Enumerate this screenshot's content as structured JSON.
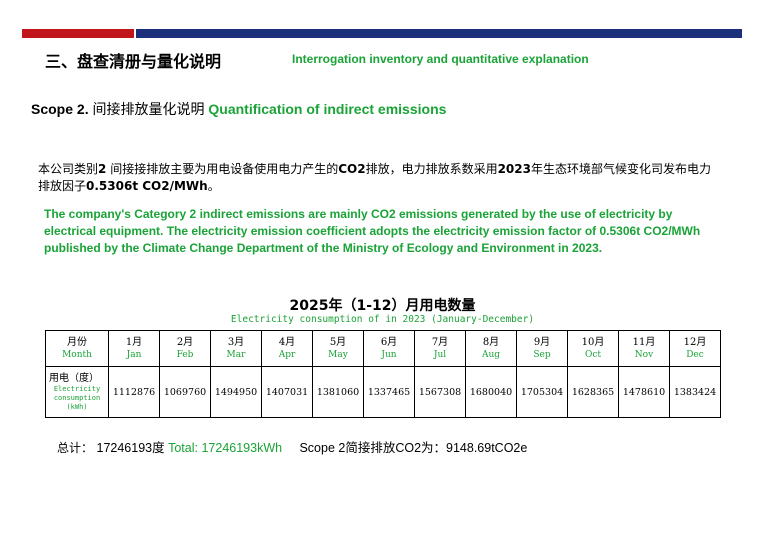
{
  "header": {
    "section_cn": "三、盘查清册与量化说明",
    "section_en": "Interrogation inventory and quantitative explanation",
    "accent_red": "#c0161c",
    "accent_blue": "#1c2f7a",
    "accent_green": "#1aa337"
  },
  "scope": {
    "label": "Scope 2.",
    "title_cn": "间接排放量化说明",
    "title_en": "Quantification of indirect emissions"
  },
  "paragraph_cn": {
    "p1": "本公司类别",
    "b1": "2",
    "p2": " 间接接排放主要为用电设备使用电力产生的",
    "b2": "CO2",
    "p3": "排放，电力排放系数采用",
    "b3": "2023",
    "p4": "年生态环境部气候变化司发布电力排放因子",
    "b4": "0.5306t CO2/MWh",
    "p5": "。"
  },
  "paragraph_en": "The company's Category 2 indirect emissions are mainly CO2 emissions generated by the use of electricity by electrical equipment. The electricity emission coefficient adopts the electricity emission factor of 0.5306t CO2/MWh published by the Climate Change Department of the Ministry of Ecology and Environment in 2023.",
  "table": {
    "title": "2025年（1-12）月用电数量",
    "subtitle": "Electricity consumption of  in 2023 (January-December)",
    "header_cn": "月份",
    "header_en": "Month",
    "row_label_cn": "用电（度）",
    "row_label_en": "Electricity consumption (kWh)",
    "months": [
      {
        "cn": "1月",
        "en": "Jan",
        "value": "1112876"
      },
      {
        "cn": "2月",
        "en": "Feb",
        "value": "1069760"
      },
      {
        "cn": "3月",
        "en": "Mar",
        "value": "1494950"
      },
      {
        "cn": "4月",
        "en": "Apr",
        "value": "1407031"
      },
      {
        "cn": "5月",
        "en": "May",
        "value": "1381060"
      },
      {
        "cn": "6月",
        "en": "Jun",
        "value": "1337465"
      },
      {
        "cn": "7月",
        "en": "Jul",
        "value": "1567308"
      },
      {
        "cn": "8月",
        "en": "Aug",
        "value": "1680040"
      },
      {
        "cn": "9月",
        "en": "Sep",
        "value": "1705304"
      },
      {
        "cn": "10月",
        "en": "Oct",
        "value": "1628365"
      },
      {
        "cn": "11月",
        "en": "Nov",
        "value": "1478610"
      },
      {
        "cn": "12月",
        "en": "Dec",
        "value": "1383424"
      }
    ]
  },
  "summary": {
    "total_cn": "总计：",
    "total_value_cn": "17246193度",
    "total_en": "Total: 17246193kWh",
    "scope_text": "Scope 2简接排放CO2为：9148.69tCO2e"
  }
}
